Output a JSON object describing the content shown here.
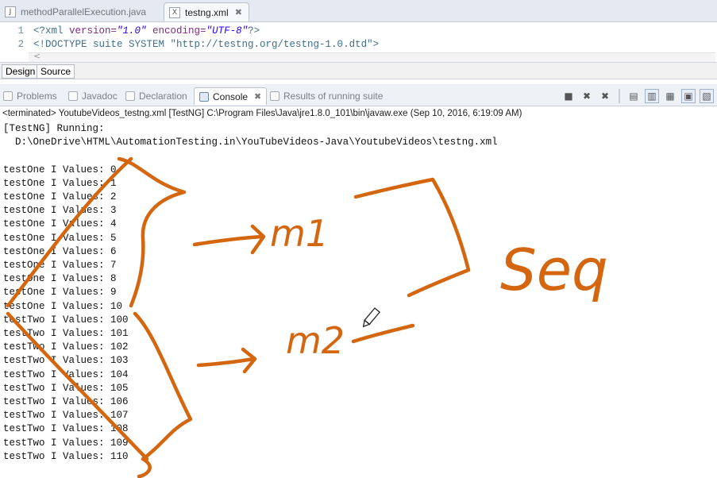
{
  "editor_tabs": [
    {
      "icon": "java-file-icon",
      "label": "methodParallelExecution.java",
      "active": false
    },
    {
      "icon": "xml-file-icon",
      "label": "testng.xml",
      "active": true,
      "close": "✖"
    }
  ],
  "editor": {
    "lines": [
      {
        "num": "1",
        "parts": [
          "<?xml ",
          "version=",
          "\"1.0\"",
          " encoding=",
          "\"UTF-8\"",
          "?>"
        ]
      },
      {
        "num": "2",
        "text": "<!DOCTYPE suite SYSTEM \"http://testng.org/testng-1.0.dtd\">"
      }
    ],
    "scroll_glyph": "<"
  },
  "bottom_tabs": {
    "design": "Design",
    "source": "Source"
  },
  "view_tabs": [
    {
      "label": "Problems"
    },
    {
      "label": "Javadoc"
    },
    {
      "label": "Declaration"
    },
    {
      "label": "Console",
      "active": true
    },
    {
      "label": "Results of running suite"
    }
  ],
  "status": "<terminated> YoutubeVideos_testng.xml [TestNG] C:\\Program Files\\Java\\jre1.8.0_101\\bin\\javaw.exe (Sep 10, 2016, 6:19:09 AM)",
  "console_lines": [
    "[TestNG] Running:",
    "  D:\\OneDrive\\HTML\\AutomationTesting.in\\YouTubeVideos-Java\\YoutubeVideos\\testng.xml",
    "",
    "testOne I Values: 0",
    "testOne I Values: 1",
    "testOne I Values: 2",
    "testOne I Values: 3",
    "testOne I Values: 4",
    "testOne I Values: 5",
    "testOne I Values: 6",
    "testOne I Values: 7",
    "testOne I Values: 8",
    "testOne I Values: 9",
    "testOne I Values: 10",
    "testTwo I Values: 100",
    "testTwo I Values: 101",
    "testTwo I Values: 102",
    "testTwo I Values: 103",
    "testTwo I Values: 104",
    "testTwo I Values: 105",
    "testTwo I Values: 106",
    "testTwo I Values: 107",
    "testTwo I Values: 108",
    "testTwo I Values: 109",
    "testTwo I Values: 110"
  ],
  "annotation": {
    "m1": "m1",
    "m2": "m2",
    "seq": "Seq",
    "color": "#d4660f"
  }
}
